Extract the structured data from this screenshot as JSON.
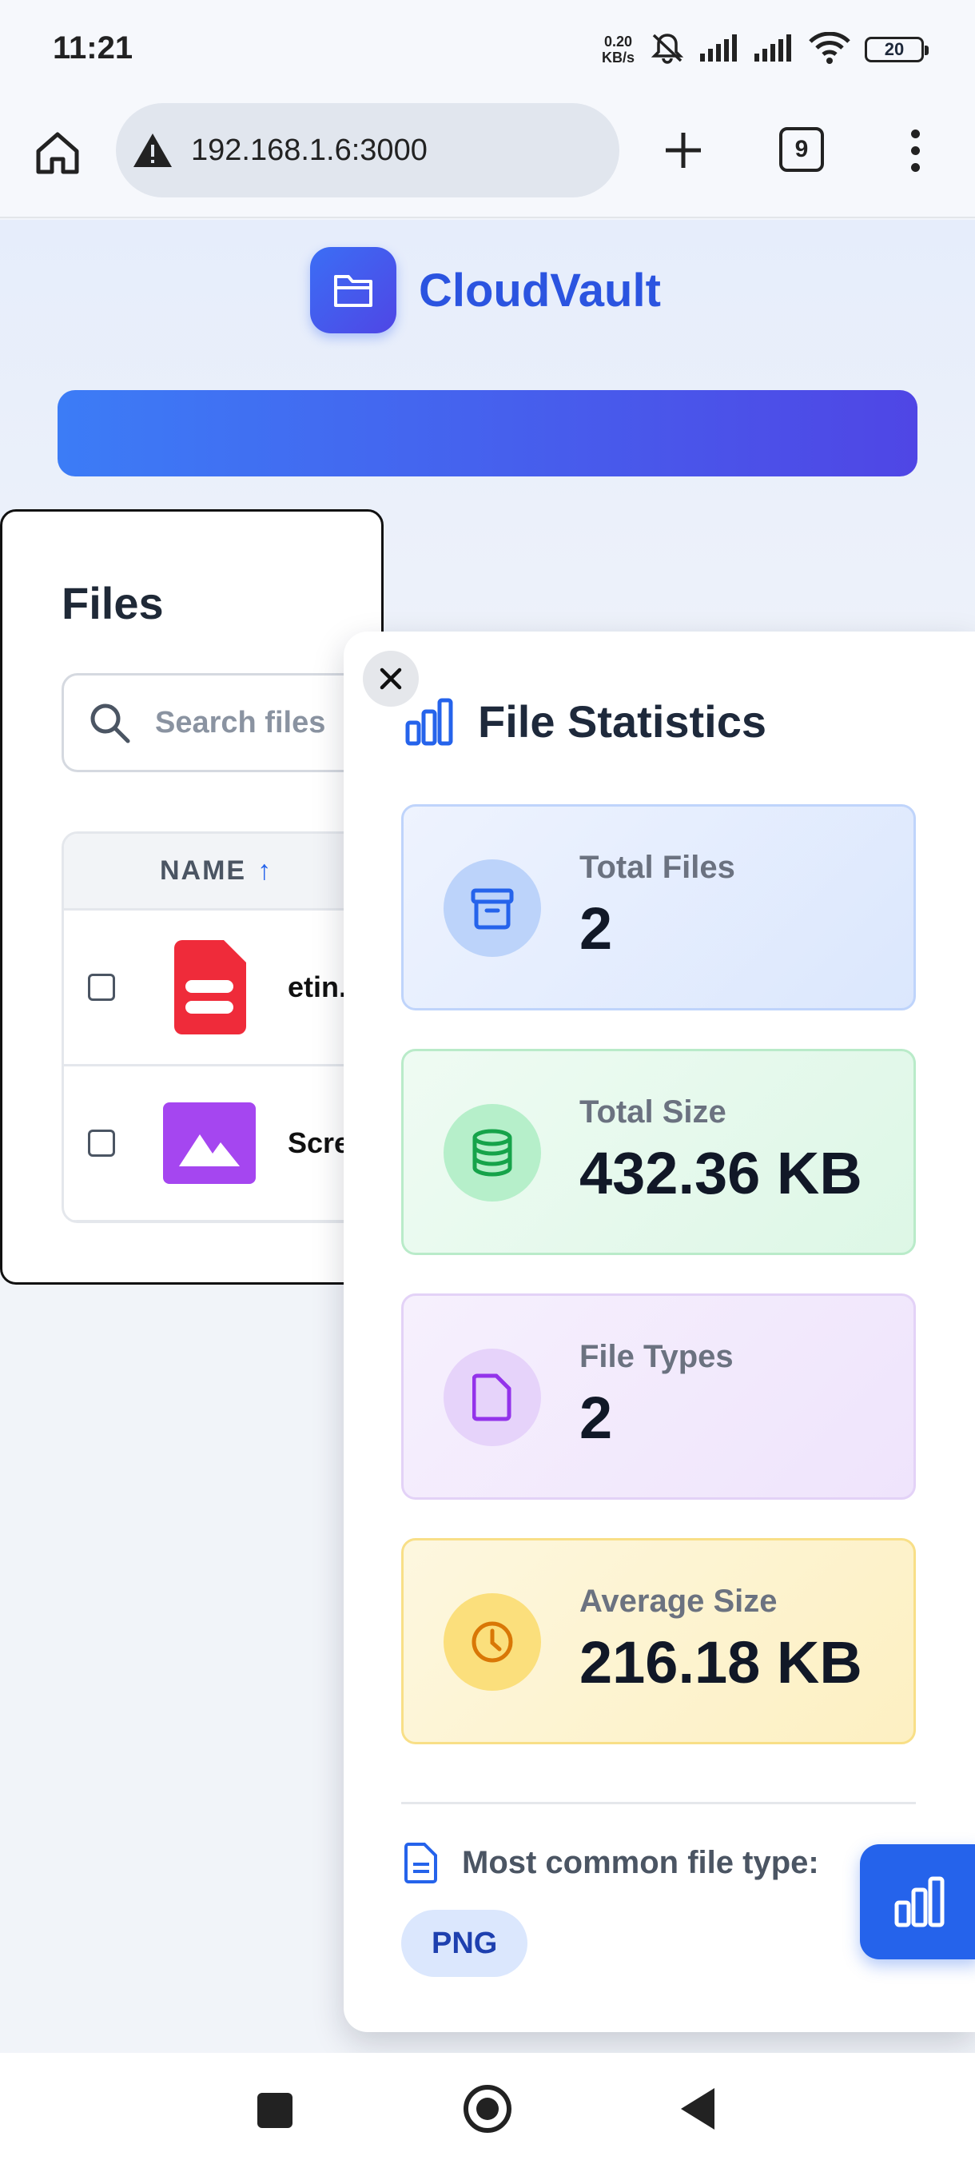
{
  "status_bar": {
    "time": "11:21",
    "net_speed_value": "0.20",
    "net_speed_unit": "KB/s",
    "battery": "20"
  },
  "browser": {
    "url": "192.168.1.6:3000",
    "tab_count": "9"
  },
  "app": {
    "name": "CloudVault"
  },
  "files_panel": {
    "title": "Files",
    "search_placeholder": "Search files",
    "column_name": "NAME",
    "sort_arrow": "↑",
    "rows": [
      {
        "name": "etin.",
        "type": "pdf",
        "icon": "pdf-file-icon"
      },
      {
        "name": "Scre",
        "type": "image",
        "icon": "image-file-icon"
      }
    ]
  },
  "stats": {
    "title": "File Statistics",
    "cards": [
      {
        "label": "Total Files",
        "value": "2",
        "icon": "archive-icon",
        "accent": "#2563eb"
      },
      {
        "label": "Total Size",
        "value": "432.36 KB",
        "icon": "database-icon",
        "accent": "#16a34a"
      },
      {
        "label": "File Types",
        "value": "2",
        "icon": "document-icon",
        "accent": "#9333ea"
      },
      {
        "label": "Average Size",
        "value": "216.18 KB",
        "icon": "clock-icon",
        "accent": "#d97706"
      }
    ],
    "most_common_label": "Most common file type:",
    "most_common_value": "PNG"
  },
  "colors": {
    "brand": "#2b54e0",
    "fab": "#2563eb"
  }
}
